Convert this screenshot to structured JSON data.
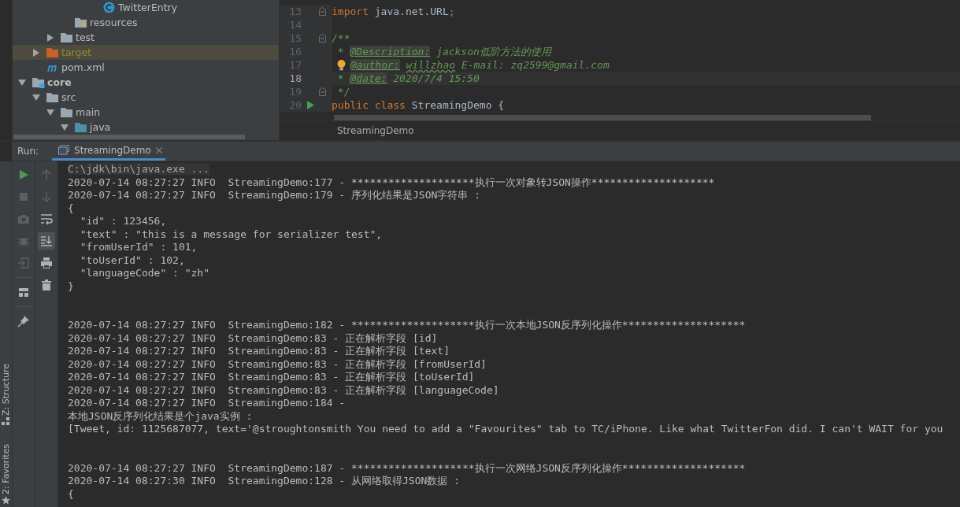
{
  "project_tree": [
    {
      "children": [
        {
          "children": [
            {
              "children": [
                {
                  "children": [
                    {
                      "children": [
                        {
                          "label": "TwitterEntry",
                          "kind": "class",
                          "selected": false
                        }
                      ]
                    }
                  ]
                },
                {
                  "label": "resources",
                  "kind": "resources-folder",
                  "selected": false
                }
              ]
            },
            {
              "label": "test",
              "kind": "folder",
              "expanded": false,
              "selected": false
            }
          ]
        },
        {
          "label": "target",
          "kind": "excluded-folder",
          "expanded": false,
          "selected": true
        },
        {
          "label": "pom.xml",
          "kind": "maven",
          "selected": false
        }
      ]
    },
    {
      "label": "core",
      "kind": "module",
      "expanded": true,
      "selected": false,
      "children": [
        {
          "label": "src",
          "kind": "folder",
          "expanded": true,
          "selected": false,
          "children": [
            {
              "label": "main",
              "kind": "folder",
              "expanded": true,
              "selected": false,
              "children": [
                {
                  "label": "java",
                  "kind": "source-folder",
                  "expanded": true,
                  "selected": false
                }
              ]
            }
          ]
        }
      ]
    }
  ],
  "editor": {
    "lines": [
      {
        "number": "13",
        "kind": "plain",
        "current": false,
        "fold": true,
        "tokens": [
          {
            "kind": "keyword",
            "text": "import"
          },
          {
            "kind": "plain",
            "text": " java.net.URL"
          },
          {
            "kind": "keyword",
            "text": ";"
          }
        ]
      },
      {
        "number": "14",
        "kind": "plain",
        "current": false,
        "fold": false
      },
      {
        "number": "15",
        "kind": "plain",
        "current": false,
        "fold": true,
        "tokens": [
          {
            "kind": "doc",
            "text": "/**"
          }
        ]
      },
      {
        "number": "16",
        "kind": "plain",
        "current": false,
        "fold": false,
        "tokens": [
          {
            "kind": "doc",
            "text": " * "
          },
          {
            "kind": "doctag",
            "text": "@Description:"
          },
          {
            "kind": "doc",
            "text": " jackson低阶方法的使用"
          }
        ]
      },
      {
        "number": "17",
        "kind": "bulb",
        "current": false,
        "fold": false,
        "tokens": [
          {
            "kind": "doctag",
            "text": "@author:"
          },
          {
            "kind": "docwarn",
            "text": "willzhao"
          },
          {
            "kind": "doc",
            "text": " E-mail: zq2599@gmail.com"
          }
        ]
      },
      {
        "number": "18",
        "kind": "plain",
        "current": true,
        "fold": false,
        "tokens": [
          {
            "kind": "doc",
            "text": " * "
          },
          {
            "kind": "doctag",
            "text": "@date:"
          },
          {
            "kind": "doc",
            "text": " 2020/7/4 15:50"
          }
        ]
      },
      {
        "number": "19",
        "kind": "plain",
        "current": false,
        "fold": true,
        "tokens": [
          {
            "kind": "doc",
            "text": " */"
          }
        ]
      },
      {
        "number": "20",
        "kind": "run",
        "current": false,
        "fold": false,
        "tokens": [
          {
            "kind": "keyword",
            "text": "public class "
          },
          {
            "kind": "plain",
            "text": "StreamingDemo {"
          }
        ]
      }
    ],
    "breadcrumb": "StreamingDemo"
  },
  "run_panel": {
    "label": "Run:",
    "tab": "StreamingDemo",
    "toolbar_left": [
      {
        "kind": "run",
        "disabled": false,
        "on": false
      },
      {
        "kind": "stop",
        "disabled": true,
        "on": false
      },
      {
        "kind": "camera",
        "disabled": true,
        "on": false
      },
      {
        "kind": "bug",
        "disabled": true,
        "on": false
      },
      {
        "kind": "exit",
        "disabled": true,
        "on": false
      },
      {
        "kind": "separator"
      },
      {
        "kind": "layout",
        "disabled": false,
        "on": false
      },
      {
        "kind": "separator"
      },
      {
        "kind": "pin",
        "disabled": false,
        "on": false
      }
    ],
    "toolbar_right": [
      {
        "kind": "up",
        "disabled": true,
        "on": false
      },
      {
        "kind": "down",
        "disabled": true,
        "on": false
      },
      {
        "kind": "wrap",
        "disabled": false,
        "on": false
      },
      {
        "kind": "scroll-end",
        "disabled": false,
        "on": true
      },
      {
        "kind": "print",
        "disabled": false,
        "on": false
      },
      {
        "kind": "trash",
        "disabled": false,
        "on": false
      }
    ],
    "console": [
      {
        "kind": "command",
        "text": "C:\\jdk\\bin\\java.exe ..."
      },
      {
        "kind": "output",
        "text": "2020-07-14 08:27:27 INFO  StreamingDemo:177 - ********************执行一次对象转JSON操作********************"
      },
      {
        "kind": "output",
        "text": "2020-07-14 08:27:27 INFO  StreamingDemo:179 - 序列化结果是JSON字符串 :"
      },
      {
        "kind": "output",
        "text": "{"
      },
      {
        "kind": "output",
        "text": "  \"id\" : 123456,"
      },
      {
        "kind": "output",
        "text": "  \"text\" : \"this is a message for serializer test\","
      },
      {
        "kind": "output",
        "text": "  \"fromUserId\" : 101,"
      },
      {
        "kind": "output",
        "text": "  \"toUserId\" : 102,"
      },
      {
        "kind": "output",
        "text": "  \"languageCode\" : \"zh\""
      },
      {
        "kind": "output",
        "text": "}"
      },
      {
        "kind": "blank"
      },
      {
        "kind": "blank"
      },
      {
        "kind": "output",
        "text": "2020-07-14 08:27:27 INFO  StreamingDemo:182 - ********************执行一次本地JSON反序列化操作********************"
      },
      {
        "kind": "output",
        "text": "2020-07-14 08:27:27 INFO  StreamingDemo:83 - 正在解析字段 [id]"
      },
      {
        "kind": "output",
        "text": "2020-07-14 08:27:27 INFO  StreamingDemo:83 - 正在解析字段 [text]"
      },
      {
        "kind": "output",
        "text": "2020-07-14 08:27:27 INFO  StreamingDemo:83 - 正在解析字段 [fromUserId]"
      },
      {
        "kind": "output",
        "text": "2020-07-14 08:27:27 INFO  StreamingDemo:83 - 正在解析字段 [toUserId]"
      },
      {
        "kind": "output",
        "text": "2020-07-14 08:27:27 INFO  StreamingDemo:83 - 正在解析字段 [languageCode]"
      },
      {
        "kind": "output",
        "text": "2020-07-14 08:27:27 INFO  StreamingDemo:184 -"
      },
      {
        "kind": "output",
        "text": "本地JSON反序列化结果是个java实例 :"
      },
      {
        "kind": "output",
        "text": "[Tweet, id: 1125687077, text='@stroughtonsmith You need to add a \"Favourites\" tab to TC/iPhone. Like what TwitterFon did. I can't WAIT for you"
      },
      {
        "kind": "blank"
      },
      {
        "kind": "blank"
      },
      {
        "kind": "output",
        "text": "2020-07-14 08:27:27 INFO  StreamingDemo:187 - ********************执行一次网络JSON反序列化操作********************"
      },
      {
        "kind": "output",
        "text": "2020-07-14 08:27:30 INFO  StreamingDemo:128 - 从网络取得JSON数据 :"
      },
      {
        "kind": "output",
        "text": "{"
      }
    ]
  },
  "side_tabs": [
    {
      "label": "Z: Structure",
      "kind": "structure"
    },
    {
      "label": "2: Favorites",
      "kind": "favorites"
    }
  ]
}
